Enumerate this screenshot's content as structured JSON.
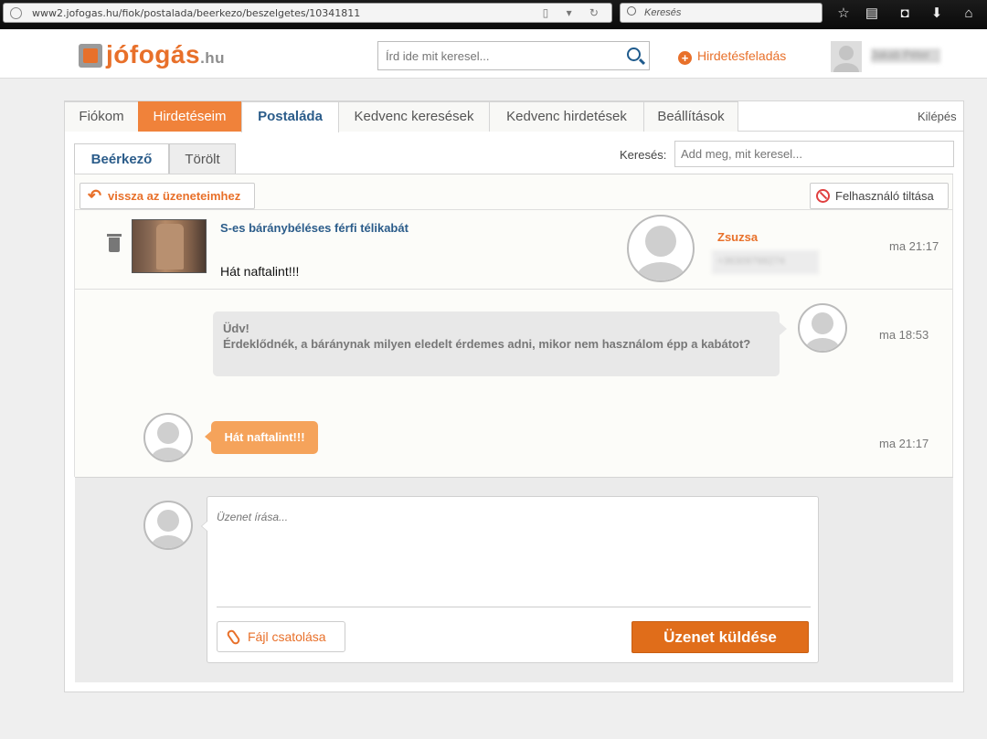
{
  "browser": {
    "url_host": "www2.jofogas.hu",
    "url_path": "/fiok/postalada/beerkezo/beszelgetes/10341811",
    "search_placeholder": "Keresés"
  },
  "header": {
    "logo_main": "jófogás",
    "logo_tld": ".hu",
    "search_placeholder": "Írd ide mit keresel...",
    "post_ad_label": "Hirdetésfeladás",
    "user_name": "Jakab Péter"
  },
  "tabs": [
    {
      "label": "Fiókom"
    },
    {
      "label": "Hirdetéseim"
    },
    {
      "label": "Postaláda"
    },
    {
      "label": "Kedvenc keresések"
    },
    {
      "label": "Kedvenc hirdetések"
    },
    {
      "label": "Beállítások"
    }
  ],
  "logout_label": "Kilépés",
  "subtabs": [
    {
      "label": "Beérkező"
    },
    {
      "label": "Törölt"
    }
  ],
  "inbox_search": {
    "label": "Keresés:",
    "placeholder": "Add meg, mit keresel..."
  },
  "actions": {
    "back_label": "vissza az üzeneteimhez",
    "block_label": "Felhasználó tiltása"
  },
  "conversation": {
    "ad_title": "S-es báránybéléses férfi télikabát",
    "last_message": "Hát naftalint!!!",
    "partner_name": "Zsuzsa",
    "partner_phone": "+36309766274",
    "time": "ma 21:17"
  },
  "messages": [
    {
      "line1": "Üdv!",
      "line2": "Érdeklődnék, a báránynak milyen eledelt érdemes adni, mikor nem használom épp a kabátot?",
      "time": "ma 18:53"
    },
    {
      "text": "Hát naftalint!!!",
      "time": "ma 21:17"
    }
  ],
  "compose": {
    "placeholder": "Üzenet írása...",
    "attach_label": "Fájl csatolása",
    "send_label": "Üzenet küldése"
  },
  "colors": {
    "brand_orange": "#e8702a",
    "link_blue": "#2b5c8a"
  }
}
